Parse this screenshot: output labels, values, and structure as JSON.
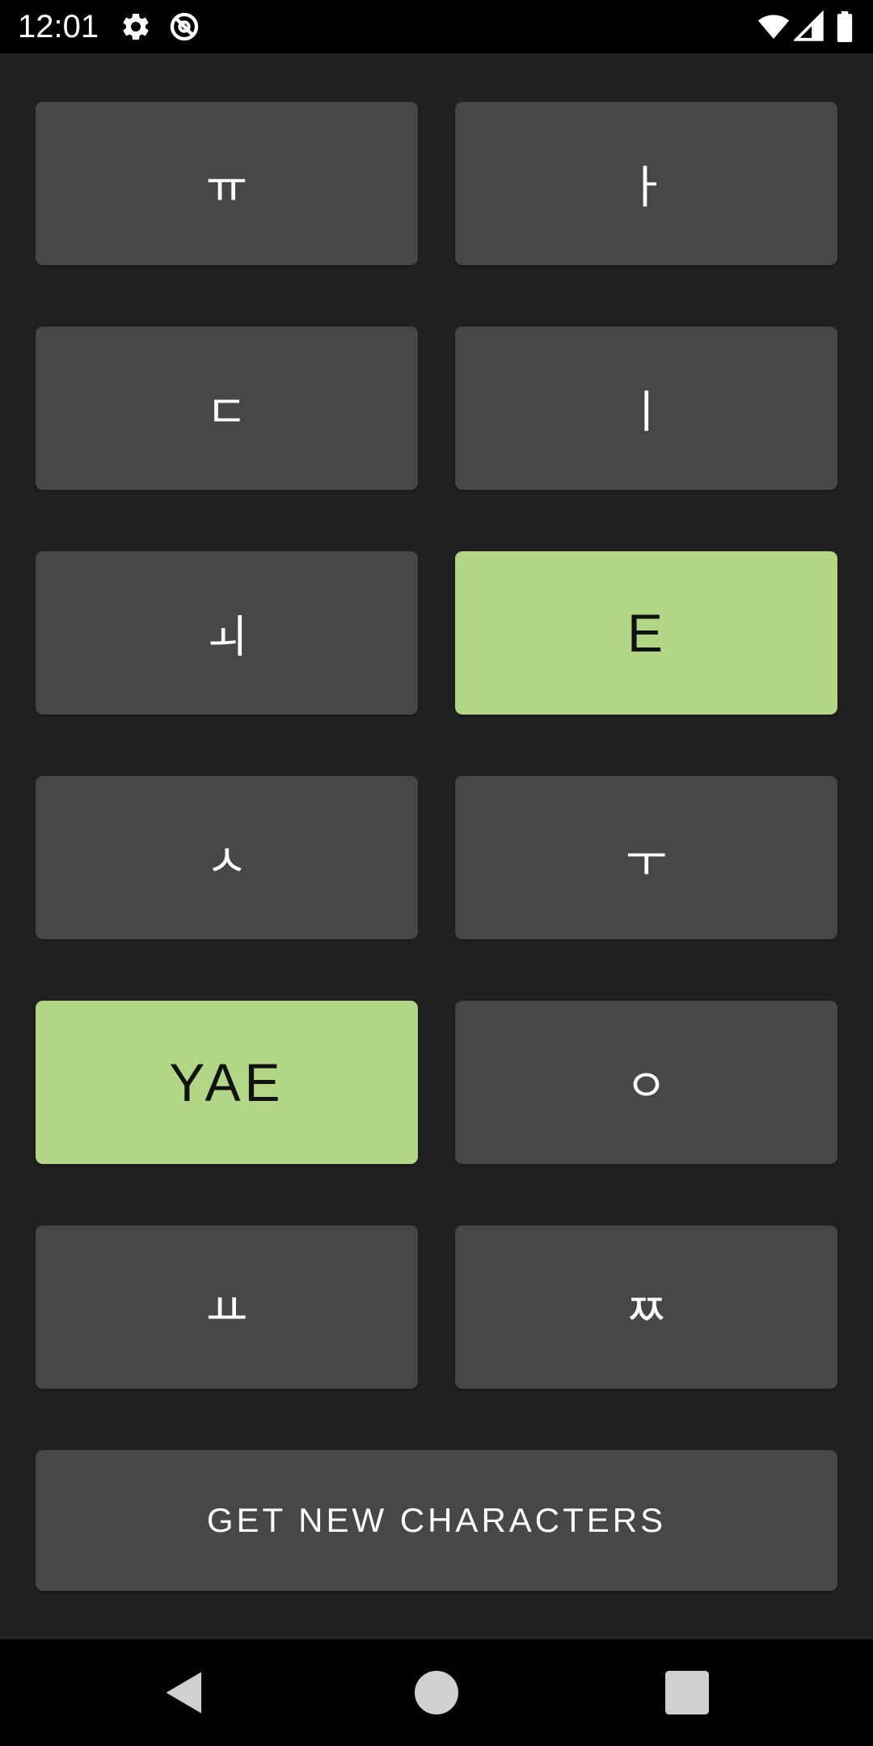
{
  "status_bar": {
    "time": "12:01",
    "icons": [
      "settings-icon",
      "data-saver-icon",
      "wifi-icon",
      "signal-icon",
      "battery-icon"
    ]
  },
  "tiles": [
    {
      "label": "ㅠ",
      "selected": false
    },
    {
      "label": "ㅏ",
      "selected": false
    },
    {
      "label": "ㄷ",
      "selected": false
    },
    {
      "label": "ㅣ",
      "selected": false
    },
    {
      "label": "ㅚ",
      "selected": false
    },
    {
      "label": "E",
      "selected": true
    },
    {
      "label": "ㅅ",
      "selected": false
    },
    {
      "label": "ㅜ",
      "selected": false
    },
    {
      "label": "YAE",
      "selected": true
    },
    {
      "label": "ㅇ",
      "selected": false
    },
    {
      "label": "ㅛ",
      "selected": false
    },
    {
      "label": "ㅉ",
      "selected": false
    }
  ],
  "action_button": {
    "label": "GET NEW CHARACTERS"
  },
  "nav_bar": {
    "buttons": [
      "back-icon",
      "home-icon",
      "recents-icon"
    ]
  },
  "colors": {
    "background": "#212121",
    "tile": "#474747",
    "tile_selected": "#b0d686",
    "text": "#ffffff",
    "text_selected": "#111111"
  }
}
